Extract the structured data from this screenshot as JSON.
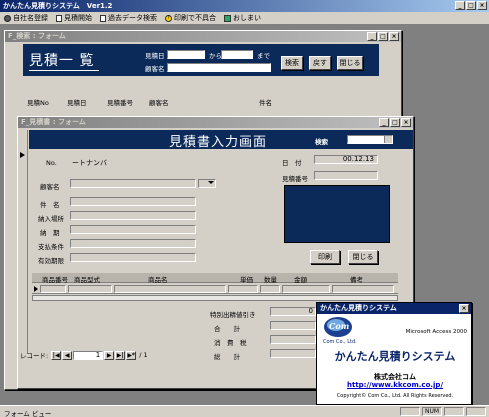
{
  "app": {
    "title": "かんたん見積りシステム　Ver1.2",
    "menu": [
      {
        "label": "自社名登録",
        "icon": "gear-icon"
      },
      {
        "label": "見積開始",
        "icon": "document-icon"
      },
      {
        "label": "過去データ検索",
        "icon": "document-icon"
      },
      {
        "label": "印刷で不具合",
        "icon": "help-icon"
      },
      {
        "label": "おしまい",
        "icon": "exit-icon"
      }
    ],
    "status_left": "フォーム ビュー",
    "status_num": "NUM"
  },
  "search_form": {
    "title": "F_検索 : フォーム",
    "heading": "見積一 覧",
    "date_label": "見積日",
    "date_from": "から",
    "date_to": "まで",
    "customer_label": "顧客名",
    "buttons": {
      "search": "検索",
      "back": "戻す",
      "close": "閉じる"
    },
    "columns": [
      "見積No",
      "見積日",
      "見積番号",
      "顧客名",
      "件名"
    ]
  },
  "entry_form": {
    "title": "F_見積書 : フォーム",
    "heading": "見積書入力画面",
    "search_label": "検索",
    "no_label": "No.",
    "no_value": "ートナンバ",
    "date_label": "日　付",
    "date_value": "00.12.13",
    "quote_no_label": "見積番号",
    "customer_label": "顧客名",
    "fields": [
      "件　名",
      "納入場所",
      "納　期",
      "支払条件",
      "有効期限"
    ],
    "print_button": "印刷",
    "close_button": "閉じる",
    "detail_columns": [
      "商品番号",
      "商品型式",
      "商品名",
      "単価",
      "数量",
      "金額",
      "備考"
    ],
    "special_discount_label": "特別出精値引き",
    "special_discount_value": "0",
    "subtotal_label": "合　　計",
    "tax_label": "消　費　税",
    "total_label": "総　　計",
    "record_label": "レコード:",
    "record_current": "1",
    "record_total": "/ 1"
  },
  "splash": {
    "title": "かんたん見積りシステム",
    "company_logo": "Com Co., Ltd.",
    "platform": "Microsoft Access 2000",
    "product": "かんたん見積りシステム",
    "company": "株式会社コム",
    "url": "http://www.kkcom.co.jp/",
    "copyright": "Copyright© Com Co., Ltd. All Rights Reserved."
  }
}
